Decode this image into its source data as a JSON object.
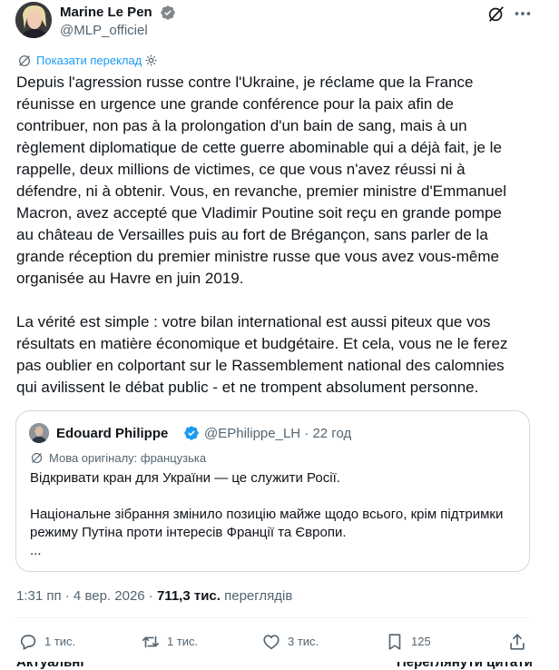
{
  "author": {
    "name": "Marine Le Pen",
    "handle": "@MLP_officiel"
  },
  "translate": {
    "label": "Показати переклад"
  },
  "tweet": {
    "paragraph1": [
      "Depuis l'agression russe contre l'Ukraine, je réclame que la France",
      "réunisse en urgence une grande conférence pour la paix afin de",
      "contribuer, non pas à la prolongation d'un bain de sang, mais à un",
      "règlement diplomatique de cette guerre abominable qui a déjà fait, je le",
      "rappelle, deux millions de victimes, ce que vous n'avez réussi ni à",
      "défendre, ni à obtenir. Vous, en revanche, premier ministre d'Emmanuel",
      "Macron, avez accepté que Vladimir Poutine soit reçu en grande pompe",
      "au château de Versailles puis au fort de Brégançon, sans parler de la",
      "grande réception du premier ministre russe que vous avez vous-même",
      "organisée au Havre en juin 2019."
    ],
    "paragraph2": [
      "La vérité est simple : votre bilan international est aussi piteux que vos",
      "résultats en matière économique et budgétaire. Et cela, vous ne le ferez",
      "pas oublier en colportant sur le Rassemblement national des calomnies",
      "qui avilissent le débat public - et ne trompent absolument personne."
    ]
  },
  "quote": {
    "name": "Edouard Philippe",
    "handle_time": "@EPhilippe_LH · 22 год",
    "original_language": "Мова оригіналу: французька",
    "line1": "Відкривати кран для України — це служити Росії.",
    "paragraph2": [
      "Національне зібрання змінило позицію майже щодо всього, крім підтримки",
      "режиму Путіна проти інтересів Франції та Європи."
    ],
    "ellipsis": "..."
  },
  "meta": {
    "time_date": "1:31 пп · 4 вер. 2026 · ",
    "views_count": "711,3 тис.",
    "views_label": " переглядів"
  },
  "actions": {
    "replies": "1 тис.",
    "reposts": "1 тис.",
    "likes": "3 тис.",
    "bookmarks": "125"
  },
  "bottom": {
    "relevant": "Актуальні",
    "read_replies": "Переглянути цитати"
  },
  "colors": {
    "accent": "#1d9bf0",
    "text": "#0f1419",
    "muted": "#536471",
    "border": "#cfd9de"
  }
}
